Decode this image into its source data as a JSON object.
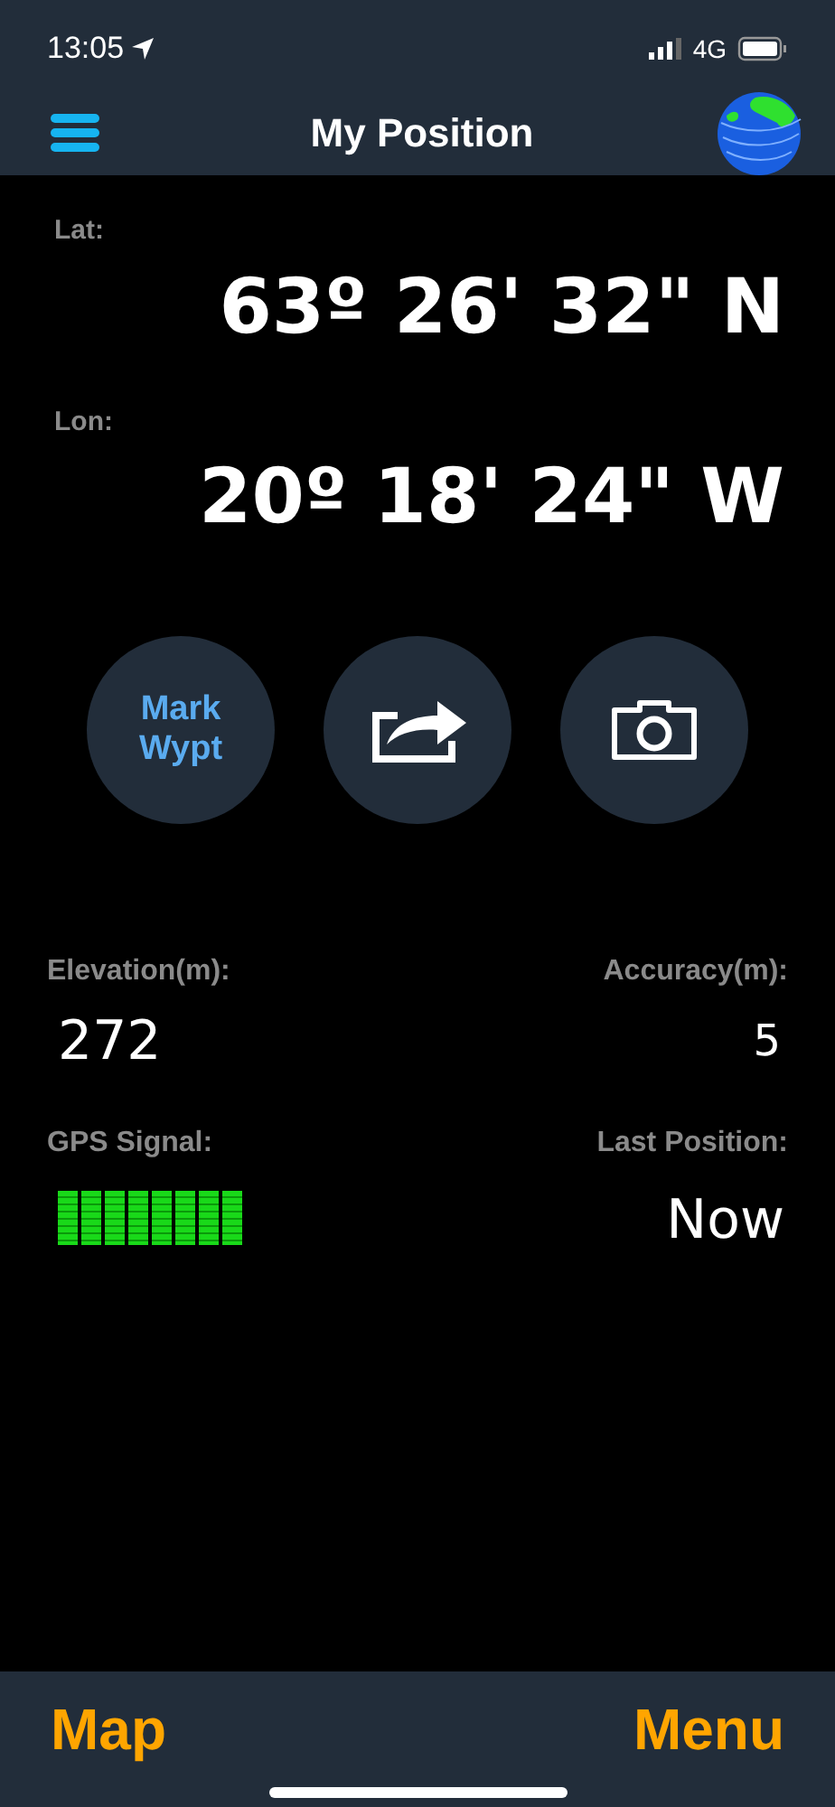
{
  "status_bar": {
    "time": "13:05",
    "network": "4G"
  },
  "header": {
    "title": "My Position"
  },
  "coordinates": [
    {
      "label": "Lat:",
      "value": "63º 26' 32\" N"
    },
    {
      "label": "Lon:",
      "value": "20º 18' 24\" W"
    }
  ],
  "actions": [
    {
      "kind": "text",
      "label": "Mark Wypt"
    },
    {
      "kind": "share"
    },
    {
      "kind": "camera"
    }
  ],
  "stats": [
    {
      "label": "Elevation(m):",
      "value": "272"
    },
    {
      "label": "Accuracy(m):",
      "value": "5"
    }
  ],
  "gps_signal": {
    "label": "GPS Signal:",
    "level": 1
  },
  "last_position": {
    "label": "Last Position:",
    "value": "Now"
  },
  "footer": {
    "left": "Map",
    "right": "Menu"
  }
}
